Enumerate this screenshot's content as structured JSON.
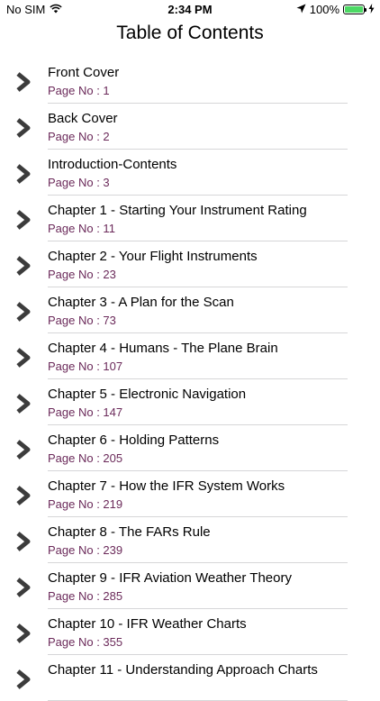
{
  "status_bar": {
    "carrier": "No SIM",
    "time": "2:34 PM",
    "battery_percent": "100%",
    "battery_level": 1.0,
    "battery_color": "#4cd964"
  },
  "nav": {
    "title": "Table of Contents"
  },
  "colors": {
    "page_text": "#6b2a5a",
    "chevron": "#3c3c3c",
    "divider": "#d6d6d8"
  },
  "icons": {
    "row_indicator": "chevron-right-icon"
  },
  "toc": [
    {
      "title": "Front Cover",
      "page": "Page No : 1"
    },
    {
      "title": "Back Cover",
      "page": "Page No : 2"
    },
    {
      "title": "Introduction-Contents",
      "page": "Page No : 3"
    },
    {
      "title": "Chapter 1 - Starting Your Instrument Rating",
      "page": "Page No : 11"
    },
    {
      "title": "Chapter 2 - Your Flight Instruments",
      "page": "Page No : 23"
    },
    {
      "title": "Chapter 3 - A Plan for the Scan",
      "page": "Page No : 73"
    },
    {
      "title": "Chapter 4 - Humans - The Plane Brain",
      "page": "Page No : 107"
    },
    {
      "title": "Chapter 5 - Electronic Navigation",
      "page": "Page No : 147"
    },
    {
      "title": "Chapter 6 - Holding Patterns",
      "page": "Page No : 205"
    },
    {
      "title": "Chapter 7 - How the IFR System Works",
      "page": "Page No : 219"
    },
    {
      "title": "Chapter 8 - The FARs Rule",
      "page": "Page No : 239"
    },
    {
      "title": "Chapter 9 - IFR Aviation Weather Theory",
      "page": "Page No : 285"
    },
    {
      "title": "Chapter 10 - IFR Weather Charts",
      "page": "Page No : 355"
    },
    {
      "title": "Chapter 11 - Understanding Approach Charts",
      "page": ""
    }
  ]
}
